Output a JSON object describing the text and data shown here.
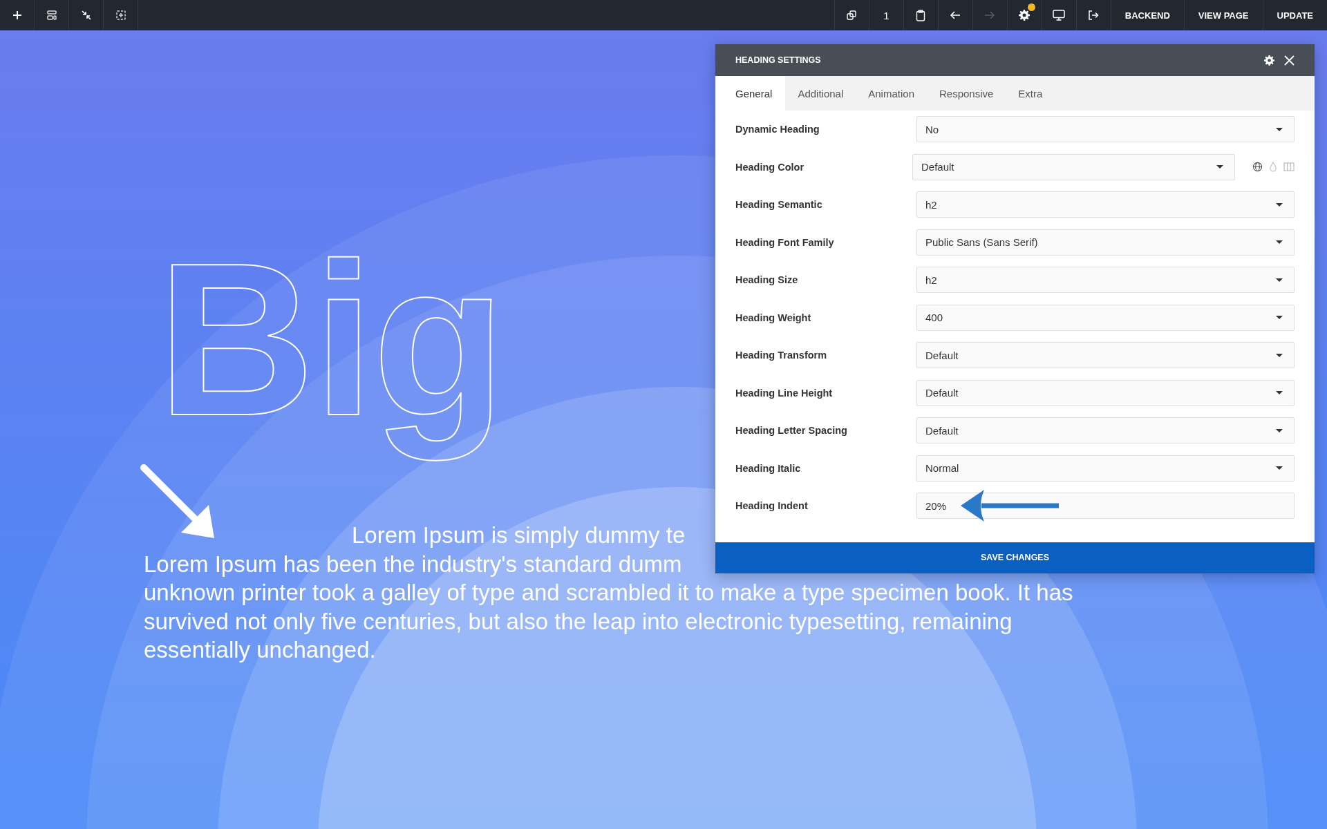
{
  "toolbar": {
    "page_count": "1",
    "undo": {
      "disabled": false
    },
    "redo": {
      "disabled": true
    },
    "settings": {
      "notification": true
    },
    "buttons": [
      "BACKEND",
      "VIEW PAGE",
      "UPDATE"
    ]
  },
  "canvas": {
    "heading": "Big",
    "paragraph_lines": [
      "Lorem Ipsum is simply dummy te",
      "Lorem Ipsum has been the industry's standard dumm",
      "unknown printer took a galley of type and scrambled it to make a type specimen book. It has",
      "survived not only five centuries, but also the leap into electronic typesetting, remaining",
      "essentially unchanged."
    ]
  },
  "panel": {
    "title": "HEADING SETTINGS",
    "tabs": [
      {
        "label": "General",
        "selected": true
      },
      {
        "label": "Additional",
        "selected": false
      },
      {
        "label": "Animation",
        "selected": false
      },
      {
        "label": "Responsive",
        "selected": false
      },
      {
        "label": "Extra",
        "selected": false
      }
    ],
    "fields": [
      {
        "label": "Dynamic Heading",
        "value": "No",
        "kind": "select"
      },
      {
        "label": "Heading Color",
        "value": "Default",
        "kind": "color-select"
      },
      {
        "label": "Heading Semantic",
        "value": "h2",
        "kind": "select"
      },
      {
        "label": "Heading Font Family",
        "value": "Public Sans (Sans Serif)",
        "kind": "select"
      },
      {
        "label": "Heading Size",
        "value": "h2",
        "kind": "select"
      },
      {
        "label": "Heading Weight",
        "value": "400",
        "kind": "select"
      },
      {
        "label": "Heading Transform",
        "value": "Default",
        "kind": "select"
      },
      {
        "label": "Heading Line Height",
        "value": "Default",
        "kind": "select"
      },
      {
        "label": "Heading Letter Spacing",
        "value": "Default",
        "kind": "select"
      },
      {
        "label": "Heading Italic",
        "value": "Normal",
        "kind": "select"
      },
      {
        "label": "Heading Indent",
        "value": "20%",
        "kind": "input"
      }
    ],
    "save_button": "SAVE CHANGES"
  }
}
